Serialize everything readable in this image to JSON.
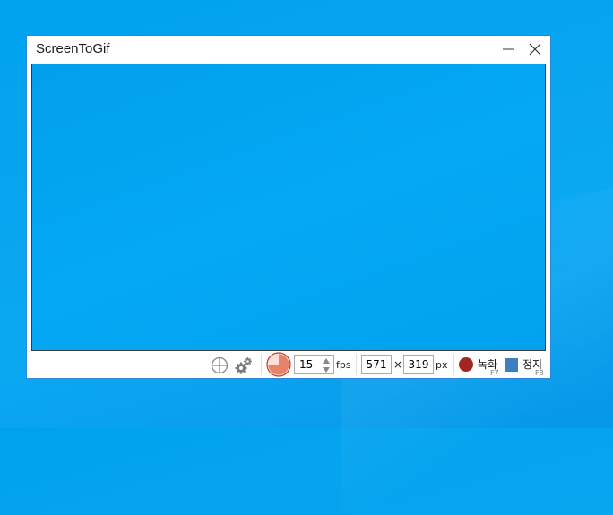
{
  "window": {
    "title": "ScreenToGif"
  },
  "toolbar": {
    "fps_value": "15",
    "fps_unit": "fps",
    "width_value": "571",
    "times_symbol": "×",
    "height_value": "319",
    "size_unit": "px",
    "record_label": "녹화",
    "record_shortcut": "F7",
    "stop_label": "정지",
    "stop_shortcut": "F8"
  },
  "icons": {
    "snap": "crosshair-icon",
    "options": "gears-icon",
    "fps_preset": "pie-timer-icon"
  },
  "colors": {
    "desktop": "#00a2ee",
    "capture_area": "#03a5f1",
    "window_border": "#2b88d8",
    "record": "#a42624",
    "stop": "#3f7fbf",
    "fps_pie": "#e8826b"
  }
}
